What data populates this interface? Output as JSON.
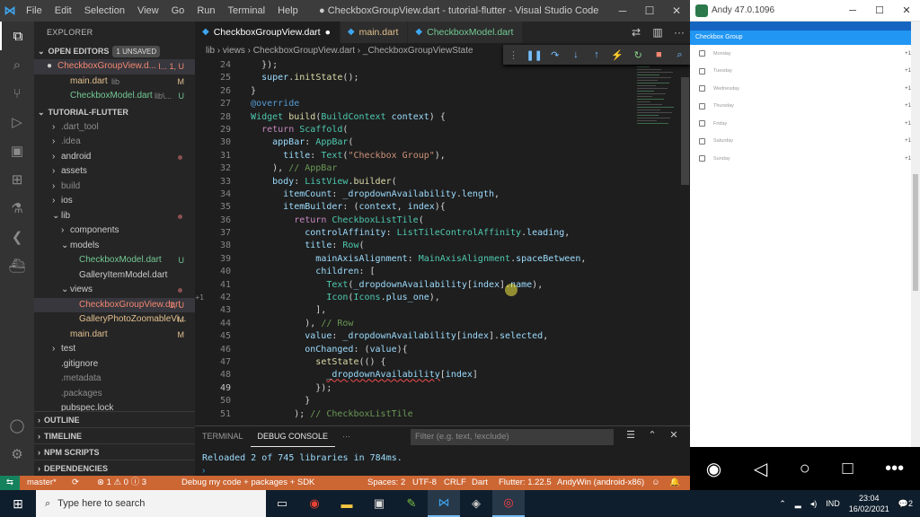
{
  "titlebar": {
    "menu": [
      "File",
      "Edit",
      "Selection",
      "View",
      "Go",
      "Run",
      "Terminal",
      "Help"
    ],
    "title": "● CheckboxGroupView.dart - tutorial-flutter - Visual Studio Code"
  },
  "sidebar": {
    "header": "EXPLORER",
    "open_editors": {
      "label": "OPEN EDITORS",
      "badge": "1 UNSAVED",
      "items": [
        {
          "name": "CheckboxGroupView.d...",
          "path": "l... 1, U"
        },
        {
          "name": "main.dart",
          "path": "lib",
          "status": "M"
        },
        {
          "name": "CheckboxModel.dart",
          "path": "lib\\...",
          "status": "U"
        }
      ]
    },
    "project": "TUTORIAL-FLUTTER",
    "tree": [
      {
        "name": ".dart_tool",
        "d": 1
      },
      {
        "name": ".idea",
        "d": 1
      },
      {
        "name": "android",
        "d": 1
      },
      {
        "name": "assets",
        "d": 1
      },
      {
        "name": "build",
        "d": 1
      },
      {
        "name": "ios",
        "d": 1
      },
      {
        "name": "lib",
        "d": 1
      },
      {
        "name": "components",
        "d": 2
      },
      {
        "name": "models",
        "d": 2
      },
      {
        "name": "CheckboxModel.dart",
        "d": 3,
        "status": "U"
      },
      {
        "name": "GalleryItemModel.dart",
        "d": 3
      },
      {
        "name": "views",
        "d": 2
      },
      {
        "name": "CheckboxGroupView.dart",
        "d": 3,
        "status": "1, U"
      },
      {
        "name": "GalleryPhotoZoomableVi...",
        "d": 3,
        "status": "M"
      },
      {
        "name": "main.dart",
        "d": 2,
        "status": "M"
      },
      {
        "name": "test",
        "d": 1
      },
      {
        "name": ".gitignore",
        "d": 1
      },
      {
        "name": ".metadata",
        "d": 1
      },
      {
        "name": ".packages",
        "d": 1
      },
      {
        "name": "pubspec.lock",
        "d": 1
      }
    ],
    "sections": [
      "OUTLINE",
      "TIMELINE",
      "NPM SCRIPTS",
      "DEPENDENCIES"
    ]
  },
  "tabs": [
    {
      "label": "CheckboxGroupView.dart"
    },
    {
      "label": "main.dart"
    },
    {
      "label": "CheckboxModel.dart"
    }
  ],
  "breadcrumb": "lib › views › CheckboxGroupView.dart › _CheckboxGroupViewState",
  "editor": {
    "line_numbers": [
      "24",
      "25",
      "26",
      "27",
      "28",
      "29",
      "30",
      "31",
      "32",
      "33",
      "34",
      "35",
      "36",
      "37",
      "38",
      "39",
      "40",
      "41",
      "42",
      "43",
      "44",
      "45",
      "46",
      "47",
      "48",
      "49",
      "50",
      "51"
    ],
    "gutter_marker": "+1"
  },
  "panel": {
    "tabs": [
      "TERMINAL",
      "DEBUG CONSOLE",
      "···"
    ],
    "filter_placeholder": "Filter (e.g. text, !exclude)",
    "output": "Reloaded 2 of 745 libraries in 784ms.",
    "prompt": "›"
  },
  "statusbar": {
    "branch": "master*",
    "sync": "⟳",
    "problems": "⊗ 1 ⚠ 0 ⓘ 3",
    "debug": "Debug my code + packages + SDK",
    "spaces": "Spaces: 2",
    "encoding": "UTF-8",
    "eol": "CRLF",
    "lang": "Dart",
    "flutter": "Flutter: 1.22.5",
    "device": "AndyWin (android-x86)"
  },
  "emulator": {
    "window_title": "Andy 47.0.1096",
    "app_title": "Checkbox Group",
    "items": [
      "Monday",
      "Tuesday",
      "Wednesday",
      "Thursday",
      "Friday",
      "Saturday",
      "Sunday"
    ],
    "plus": "+1"
  },
  "taskbar": {
    "search": "Type here to search",
    "lang": "IND",
    "time": "23:04",
    "date": "16/02/2021",
    "notif": "2"
  }
}
